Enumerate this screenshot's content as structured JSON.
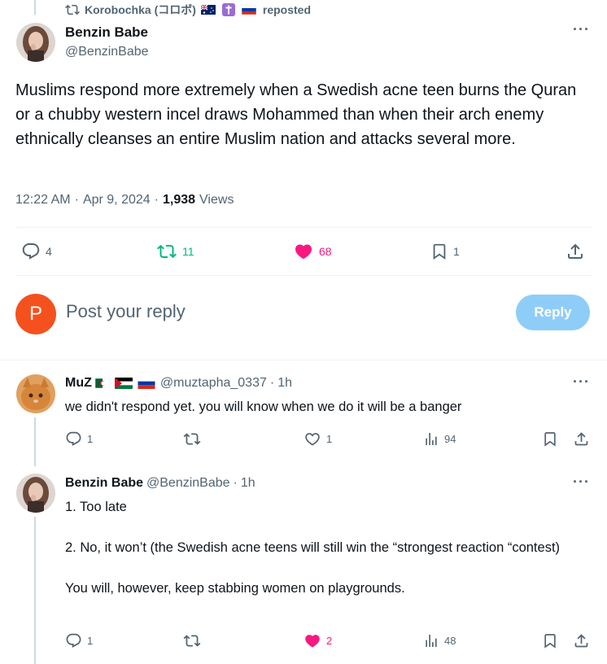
{
  "repost_header": {
    "icon": "repost-icon",
    "reposter": "Korobochka (コロボ)",
    "flags": [
      "australia-flag",
      "cross-flag",
      "russia-flag"
    ],
    "label": "reposted"
  },
  "main_tweet": {
    "display_name": "Benzin Babe",
    "handle": "@BenzinBabe",
    "text": "Muslims respond more extremely when a Swedish acne teen burns the Quran or a chubby western incel draws Mohammed than when their arch enemy ethnically cleanses an entire Muslim nation and attacks several more.",
    "time": "12:22 AM",
    "sep1": "·",
    "date": "Apr 9, 2024",
    "sep2": "·",
    "views_count": "1,938",
    "views_label": "Views",
    "replies": "4",
    "reposts": "11",
    "likes": "68",
    "bookmarks": "1"
  },
  "reply_box": {
    "avatar_letter": "P",
    "placeholder": "Post your reply",
    "button": "Reply"
  },
  "replies": [
    {
      "display_name": "MuZ",
      "flags": [
        "algeria-flag",
        "palestine-flag",
        "russia-flag"
      ],
      "handle": "@muztapha_0337",
      "sep": "·",
      "time": "1h",
      "text": "we didn't respond yet. you will know when we do it will be a banger",
      "replies": "1",
      "reposts": "",
      "likes": "1",
      "views": "94"
    },
    {
      "display_name": "Benzin Babe",
      "handle": "@BenzinBabe",
      "sep": "·",
      "time": "1h",
      "line1": "1. Too late",
      "line2": "2. No, it won’t (the Swedish acne teens will still win the “strongest reaction “contest)",
      "line3": "You will, however, keep stabbing women on playgrounds.",
      "replies": "1",
      "reposts": "",
      "likes": "2",
      "views": "48"
    }
  ],
  "colors": {
    "text": "#0f1419",
    "muted": "#536471",
    "repost_green": "#00ba7c",
    "like_pink": "#f91880",
    "reply_button": "#8ecdf8",
    "avatar_orange": "#f4511e"
  }
}
